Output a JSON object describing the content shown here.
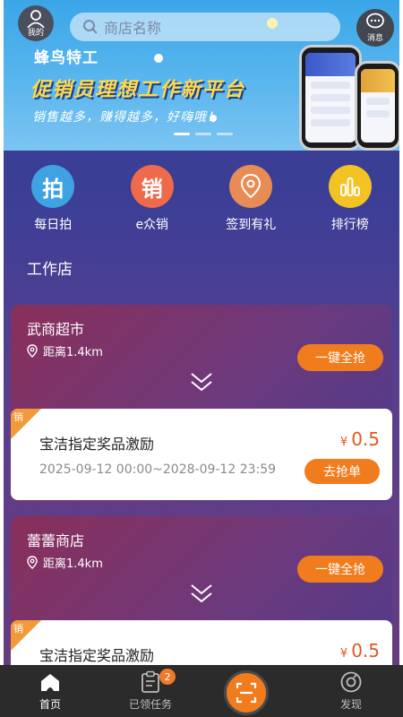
{
  "banner": {
    "avatar_label": "我的",
    "search_placeholder": "商店名称",
    "message_label": "消息",
    "brand": "蜂鸟特工",
    "slogan": "促销员理想工作新平台",
    "sub_slogan": "销售越多，赚得越多，好嗨哦！"
  },
  "categories": [
    {
      "icon_text": "拍",
      "label": "每日拍",
      "color": "#3fa2e3",
      "icon": "camera-icon"
    },
    {
      "icon_text": "销",
      "label": "e众销",
      "color": "#ef6a4a",
      "icon": "sale-icon"
    },
    {
      "icon_text": "",
      "label": "签到有礼",
      "color": "#e88b55",
      "icon": "location-pin-icon"
    },
    {
      "icon_text": "",
      "label": "排行榜",
      "color": "#f2c322",
      "icon": "bar-chart-icon"
    }
  ],
  "section_title": "工作店",
  "stores": [
    {
      "name": "武商超市",
      "distance": "距离1.4km",
      "grab_all_label": "一键全抢",
      "task": {
        "tag": "销",
        "name": "宝洁指定奖品激励",
        "currency": "¥",
        "price": "0.5",
        "period": "2025-09-12 00:00~2028-09-12 23:59",
        "action_label": "去抢单"
      }
    },
    {
      "name": "蕾蕾商店",
      "distance": "距离1.4km",
      "grab_all_label": "一键全抢",
      "task": {
        "tag": "销",
        "name": "宝洁指定奖品激励",
        "currency": "¥",
        "price": "0.5",
        "period": "",
        "action_label": ""
      }
    }
  ],
  "tabbar": {
    "home": "首页",
    "tasks": "已领任务",
    "tasks_badge": "2",
    "discover": "发现"
  }
}
